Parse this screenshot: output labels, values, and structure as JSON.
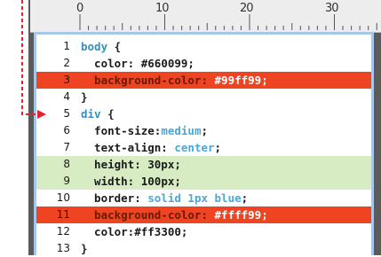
{
  "ruler": {
    "marks": [
      "0",
      "10",
      "20",
      "30"
    ]
  },
  "lines": [
    {
      "n": "1",
      "hl": "",
      "segs": [
        {
          "t": "body",
          "c": "#3a8fb8"
        },
        {
          "t": " {",
          "c": "#222"
        }
      ]
    },
    {
      "n": "2",
      "hl": "",
      "segs": [
        {
          "t": "  color:",
          "c": "#1a1a1a"
        },
        {
          "t": " #660099;",
          "c": "#1a1a1a"
        }
      ]
    },
    {
      "n": "3",
      "hl": "red",
      "segs": [
        {
          "t": "  background-color:",
          "c": "#6a1a00"
        },
        {
          "t": " #99ff99;",
          "c": "#ffffff"
        }
      ]
    },
    {
      "n": "4",
      "hl": "",
      "segs": [
        {
          "t": "}",
          "c": "#222"
        }
      ]
    },
    {
      "n": "5",
      "hl": "",
      "segs": [
        {
          "t": "div",
          "c": "#3a8fb8"
        },
        {
          "t": " {",
          "c": "#222"
        }
      ]
    },
    {
      "n": "6",
      "hl": "",
      "segs": [
        {
          "t": "  font-size:",
          "c": "#1a1a1a"
        },
        {
          "t": "medium",
          "c": "#4aa8d8"
        },
        {
          "t": ";",
          "c": "#1a1a1a"
        }
      ]
    },
    {
      "n": "7",
      "hl": "",
      "segs": [
        {
          "t": "  text-align:",
          "c": "#1a1a1a"
        },
        {
          "t": " center",
          "c": "#4aa8d8"
        },
        {
          "t": ";",
          "c": "#1a1a1a"
        }
      ]
    },
    {
      "n": "8",
      "hl": "green",
      "segs": [
        {
          "t": "  height:",
          "c": "#1a1a1a"
        },
        {
          "t": " 30px;",
          "c": "#1a1a1a"
        }
      ]
    },
    {
      "n": "9",
      "hl": "green",
      "segs": [
        {
          "t": "  width:",
          "c": "#1a1a1a"
        },
        {
          "t": " 100px;",
          "c": "#1a1a1a"
        }
      ]
    },
    {
      "n": "10",
      "hl": "",
      "segs": [
        {
          "t": "  border:",
          "c": "#1a1a1a"
        },
        {
          "t": " solid 1px blue",
          "c": "#4aa8d8"
        },
        {
          "t": ";",
          "c": "#1a1a1a"
        }
      ]
    },
    {
      "n": "11",
      "hl": "red",
      "segs": [
        {
          "t": "  background-color:",
          "c": "#6a1a00"
        },
        {
          "t": " #ffff99;",
          "c": "#ffffff"
        }
      ]
    },
    {
      "n": "12",
      "hl": "",
      "segs": [
        {
          "t": "  color:",
          "c": "#1a1a1a"
        },
        {
          "t": "#ff3300;",
          "c": "#1a1a1a"
        }
      ]
    },
    {
      "n": "13",
      "hl": "",
      "segs": [
        {
          "t": "}",
          "c": "#222"
        }
      ]
    }
  ],
  "colors": {
    "highlight_red": "#ee4422",
    "highlight_green": "#d8ecc4",
    "arrow": "#e8202a",
    "frame": "#a8c7e8"
  }
}
